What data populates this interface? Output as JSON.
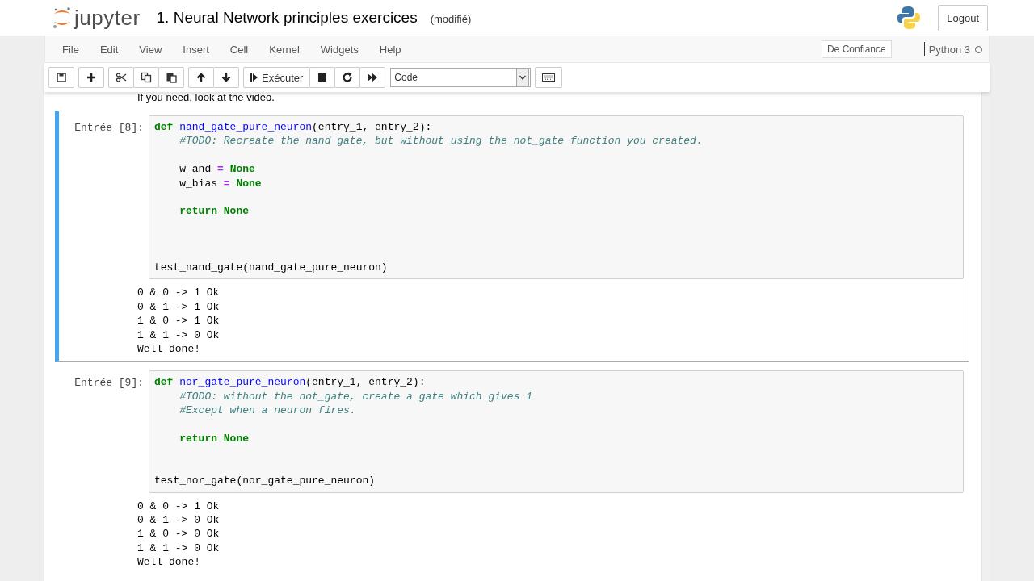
{
  "header": {
    "logo_text": "jupyter",
    "title": "1. Neural Network principles exercices",
    "save_status": "(modifié)",
    "logout": "Logout"
  },
  "menubar": {
    "items": [
      "File",
      "Edit",
      "View",
      "Insert",
      "Cell",
      "Kernel",
      "Widgets",
      "Help"
    ],
    "trusted": "De Confiance",
    "kernel": "Python 3",
    "kernel_busy": false
  },
  "toolbar": {
    "run_label": "Exécuter",
    "cell_type": "Code"
  },
  "notebook": {
    "partial_text": "If you need, look at the video.",
    "cells": [
      {
        "prompt": "Entrée [8]:",
        "selected": true,
        "code": [
          {
            "kind": "code",
            "indented": false,
            "tokens": [
              {
                "kind": "kw",
                "text": "def"
              },
              {
                "kind": "name",
                "text": " nand_gate_pure_neuron"
              },
              {
                "kind": "plain",
                "text": "(entry_1, entry_2):"
              }
            ]
          },
          {
            "kind": "code",
            "indented": true,
            "tokens": [
              {
                "kind": "comment",
                "text": "#TODO: Recreate the nand gate, but without using the not_gate function you created."
              }
            ]
          },
          {
            "kind": "blank"
          },
          {
            "kind": "code",
            "indented": true,
            "tokens": [
              {
                "kind": "plain",
                "text": "w_and "
              },
              {
                "kind": "op",
                "text": "="
              },
              {
                "kind": "kw",
                "text": " None"
              }
            ]
          },
          {
            "kind": "code",
            "indented": true,
            "tokens": [
              {
                "kind": "plain",
                "text": "w_bias "
              },
              {
                "kind": "op",
                "text": "="
              },
              {
                "kind": "kw",
                "text": " None"
              }
            ]
          },
          {
            "kind": "blank"
          },
          {
            "kind": "code",
            "indented": true,
            "tokens": [
              {
                "kind": "kw",
                "text": "return None"
              }
            ]
          },
          {
            "kind": "blank"
          },
          {
            "kind": "blank"
          },
          {
            "kind": "blank"
          },
          {
            "kind": "code",
            "indented": false,
            "tokens": [
              {
                "kind": "plain",
                "text": "test_nand_gate(nand_gate_pure_neuron)"
              }
            ]
          }
        ],
        "output": [
          "0 & 0 -> 1 Ok",
          "0 & 1 -> 1 Ok",
          "1 & 0 -> 1 Ok",
          "1 & 1 -> 0 Ok",
          "Well done!"
        ]
      },
      {
        "prompt": "Entrée [9]:",
        "selected": false,
        "code": [
          {
            "kind": "code",
            "indented": false,
            "tokens": [
              {
                "kind": "kw",
                "text": "def"
              },
              {
                "kind": "name",
                "text": " nor_gate_pure_neuron"
              },
              {
                "kind": "plain",
                "text": "(entry_1, entry_2):"
              }
            ]
          },
          {
            "kind": "code",
            "indented": true,
            "tokens": [
              {
                "kind": "comment",
                "text": "#TODO: without the not_gate, create a gate which gives 1"
              }
            ]
          },
          {
            "kind": "code",
            "indented": true,
            "tokens": [
              {
                "kind": "comment",
                "text": "#Except when a neuron fires."
              }
            ]
          },
          {
            "kind": "blank"
          },
          {
            "kind": "code",
            "indented": true,
            "tokens": [
              {
                "kind": "kw",
                "text": "return None"
              }
            ]
          },
          {
            "kind": "blank"
          },
          {
            "kind": "blank"
          },
          {
            "kind": "code",
            "indented": false,
            "tokens": [
              {
                "kind": "plain",
                "text": "test_nor_gate(nor_gate_pure_neuron)"
              }
            ]
          }
        ],
        "output": [
          "0 & 0 -> 1 Ok",
          "0 & 1 -> 0 Ok",
          "1 & 0 -> 0 Ok",
          "1 & 1 -> 0 Ok",
          "Well done!"
        ]
      }
    ]
  }
}
